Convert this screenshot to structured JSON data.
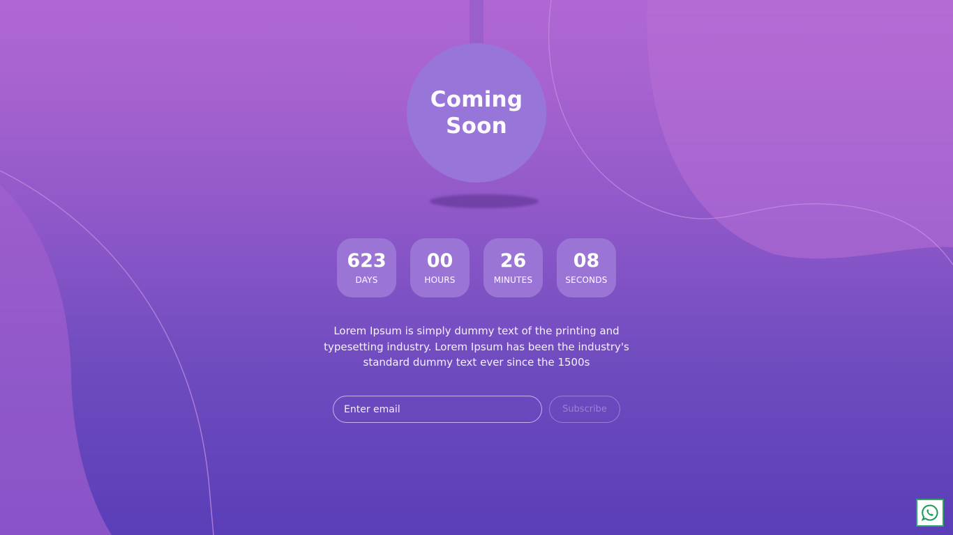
{
  "hero": {
    "title_line1": "Coming",
    "title_line2": "Soon"
  },
  "countdown": [
    {
      "value": "623",
      "label": "DAYS"
    },
    {
      "value": "00",
      "label": "HOURS"
    },
    {
      "value": "26",
      "label": "MINUTES"
    },
    {
      "value": "08",
      "label": "SECONDS"
    }
  ],
  "description": "Lorem Ipsum is simply dummy text of the printing and typesetting industry. Lorem Ipsum has been the industry's standard dummy text ever since the 1500s",
  "subscribe_form": {
    "email_placeholder": "Enter email",
    "email_value": "",
    "subscribe_label": "Subscribe"
  },
  "floating": {
    "icon": "whatsapp-icon"
  },
  "colors": {
    "background_top": "#b067d3",
    "background_bottom": "#5a3eb8",
    "circle": "#9775d9",
    "countdown_box": "#9a75d6",
    "whatsapp_green": "#2aa66a"
  }
}
